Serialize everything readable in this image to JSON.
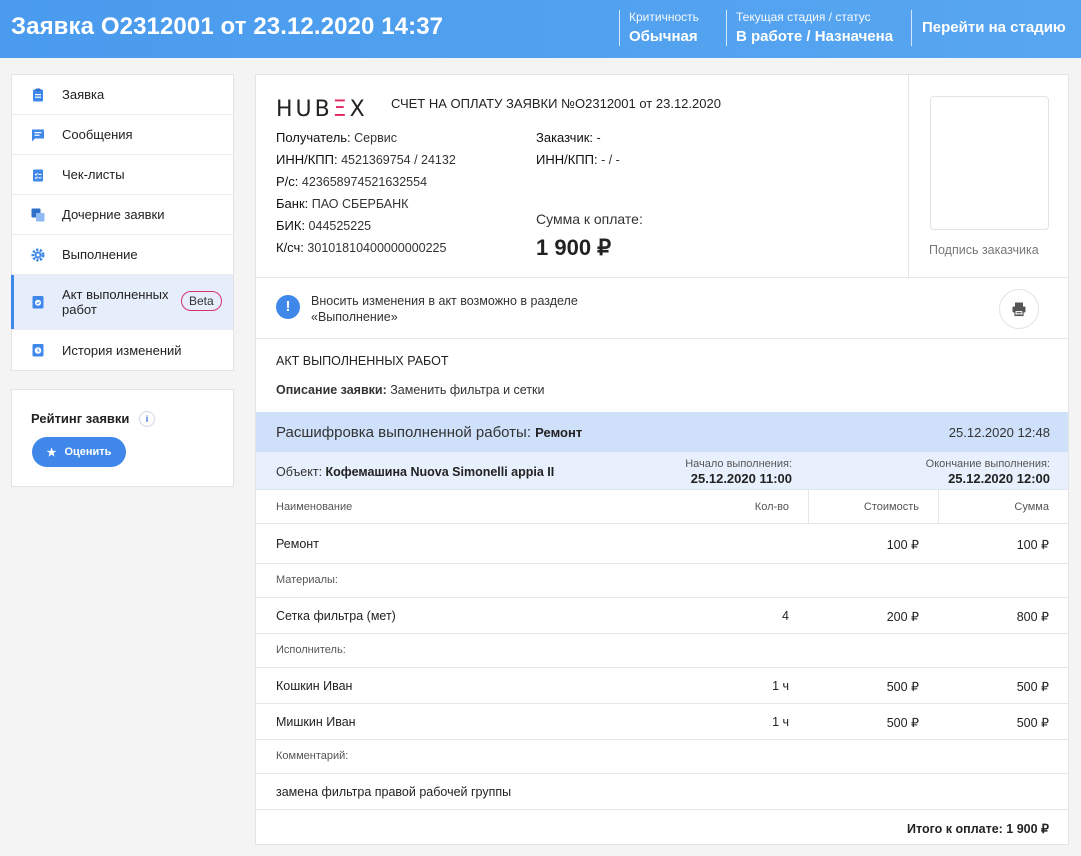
{
  "header": {
    "title": "Заявка О2312001 от 23.12.2020 14:37",
    "criticality_label": "Критичность",
    "criticality_value": "Обычная",
    "stage_label": "Текущая стадия / статус",
    "stage_value": "В работе / Назначена",
    "goto_stage": "Перейти на стадию"
  },
  "sidebar": {
    "items": [
      {
        "label": "Заявка",
        "icon": "clipboard-icon"
      },
      {
        "label": "Сообщения",
        "icon": "message-icon"
      },
      {
        "label": "Чек-листы",
        "icon": "checklist-icon"
      },
      {
        "label": "Дочерние заявки",
        "icon": "child-requests-icon"
      },
      {
        "label": "Выполнение",
        "icon": "gear-icon"
      },
      {
        "label": "Акт выполненных работ",
        "icon": "act-icon",
        "badge": "Beta",
        "active": true
      },
      {
        "label": "История изменений",
        "icon": "history-icon"
      }
    ]
  },
  "rating": {
    "title": "Рейтинг заявки",
    "info": "i",
    "button": "Оценить"
  },
  "invoice": {
    "logo_a": "HUB",
    "logo_b": "Ξ",
    "logo_c": "X",
    "title": "СЧЕТ НА ОПЛАТУ ЗАЯВКИ №О2312001 от 23.12.2020",
    "recipient_k": "Получатель:",
    "recipient_v": "Сервис",
    "inn_k": "ИНН/КПП:",
    "inn_v": "4521369754 / 24132",
    "rs_k": "Р/с:",
    "rs_v": "423658974521632554",
    "bank_k": "Банк:",
    "bank_v": "ПАО СБЕРБАНК",
    "bik_k": "БИК:",
    "bik_v": "044525225",
    "ks_k": "К/сч:",
    "ks_v": "30101810400000000225",
    "customer_k": "Заказчик:",
    "customer_v": "-",
    "cinn_k": "ИНН/КПП:",
    "cinn_v": "- / -",
    "sum_label": "Сумма к оплате:",
    "sum_value": "1 900 ₽",
    "sign_label": "Подпись заказчика"
  },
  "notice": {
    "text": "Вносить изменения в акт возможно в разделе «Выполнение»"
  },
  "act": {
    "title": "АКТ ВЫПОЛНЕННЫХ РАБОТ",
    "desc_k": "Описание заявки:",
    "desc_v": "Заменить фильтра и сетки"
  },
  "decoding": {
    "title": "Расшифровка выполненной работы:",
    "work": "Ремонт",
    "date": "25.12.2020 12:48",
    "object_k": "Объект:",
    "object_v": "Кофемашина Nuova Simonelli appia II",
    "start_label": "Начало выполнения:",
    "start_value": "25.12.2020 11:00",
    "end_label": "Окончание выполнения:",
    "end_value": "25.12.2020 12:00"
  },
  "table": {
    "headers": [
      "Наименование",
      "Кол-во",
      "Стоимость",
      "Сумма"
    ],
    "repair": {
      "name": "Ремонт",
      "qty": "",
      "price": "100 ₽",
      "sum": "100 ₽"
    },
    "materials_label": "Материалы:",
    "material": {
      "name": "Сетка фильтра (мет)",
      "qty": "4",
      "price": "200 ₽",
      "sum": "800 ₽"
    },
    "executor_label": "Исполнитель:",
    "executors": [
      {
        "name": "Кошкин Иван",
        "qty": "1 ч",
        "price": "500 ₽",
        "sum": "500 ₽"
      },
      {
        "name": "Мишкин Иван",
        "qty": "1 ч",
        "price": "500 ₽",
        "sum": "500 ₽"
      }
    ],
    "comment_label": "Комментарий:",
    "comment": "замена фильтра правой рабочей группы",
    "total": "Итого к оплате: 1 900 ₽"
  },
  "colors": {
    "accent": "#3f87e8",
    "header": "#4a9bee",
    "logo_accent": "#e0245e"
  }
}
